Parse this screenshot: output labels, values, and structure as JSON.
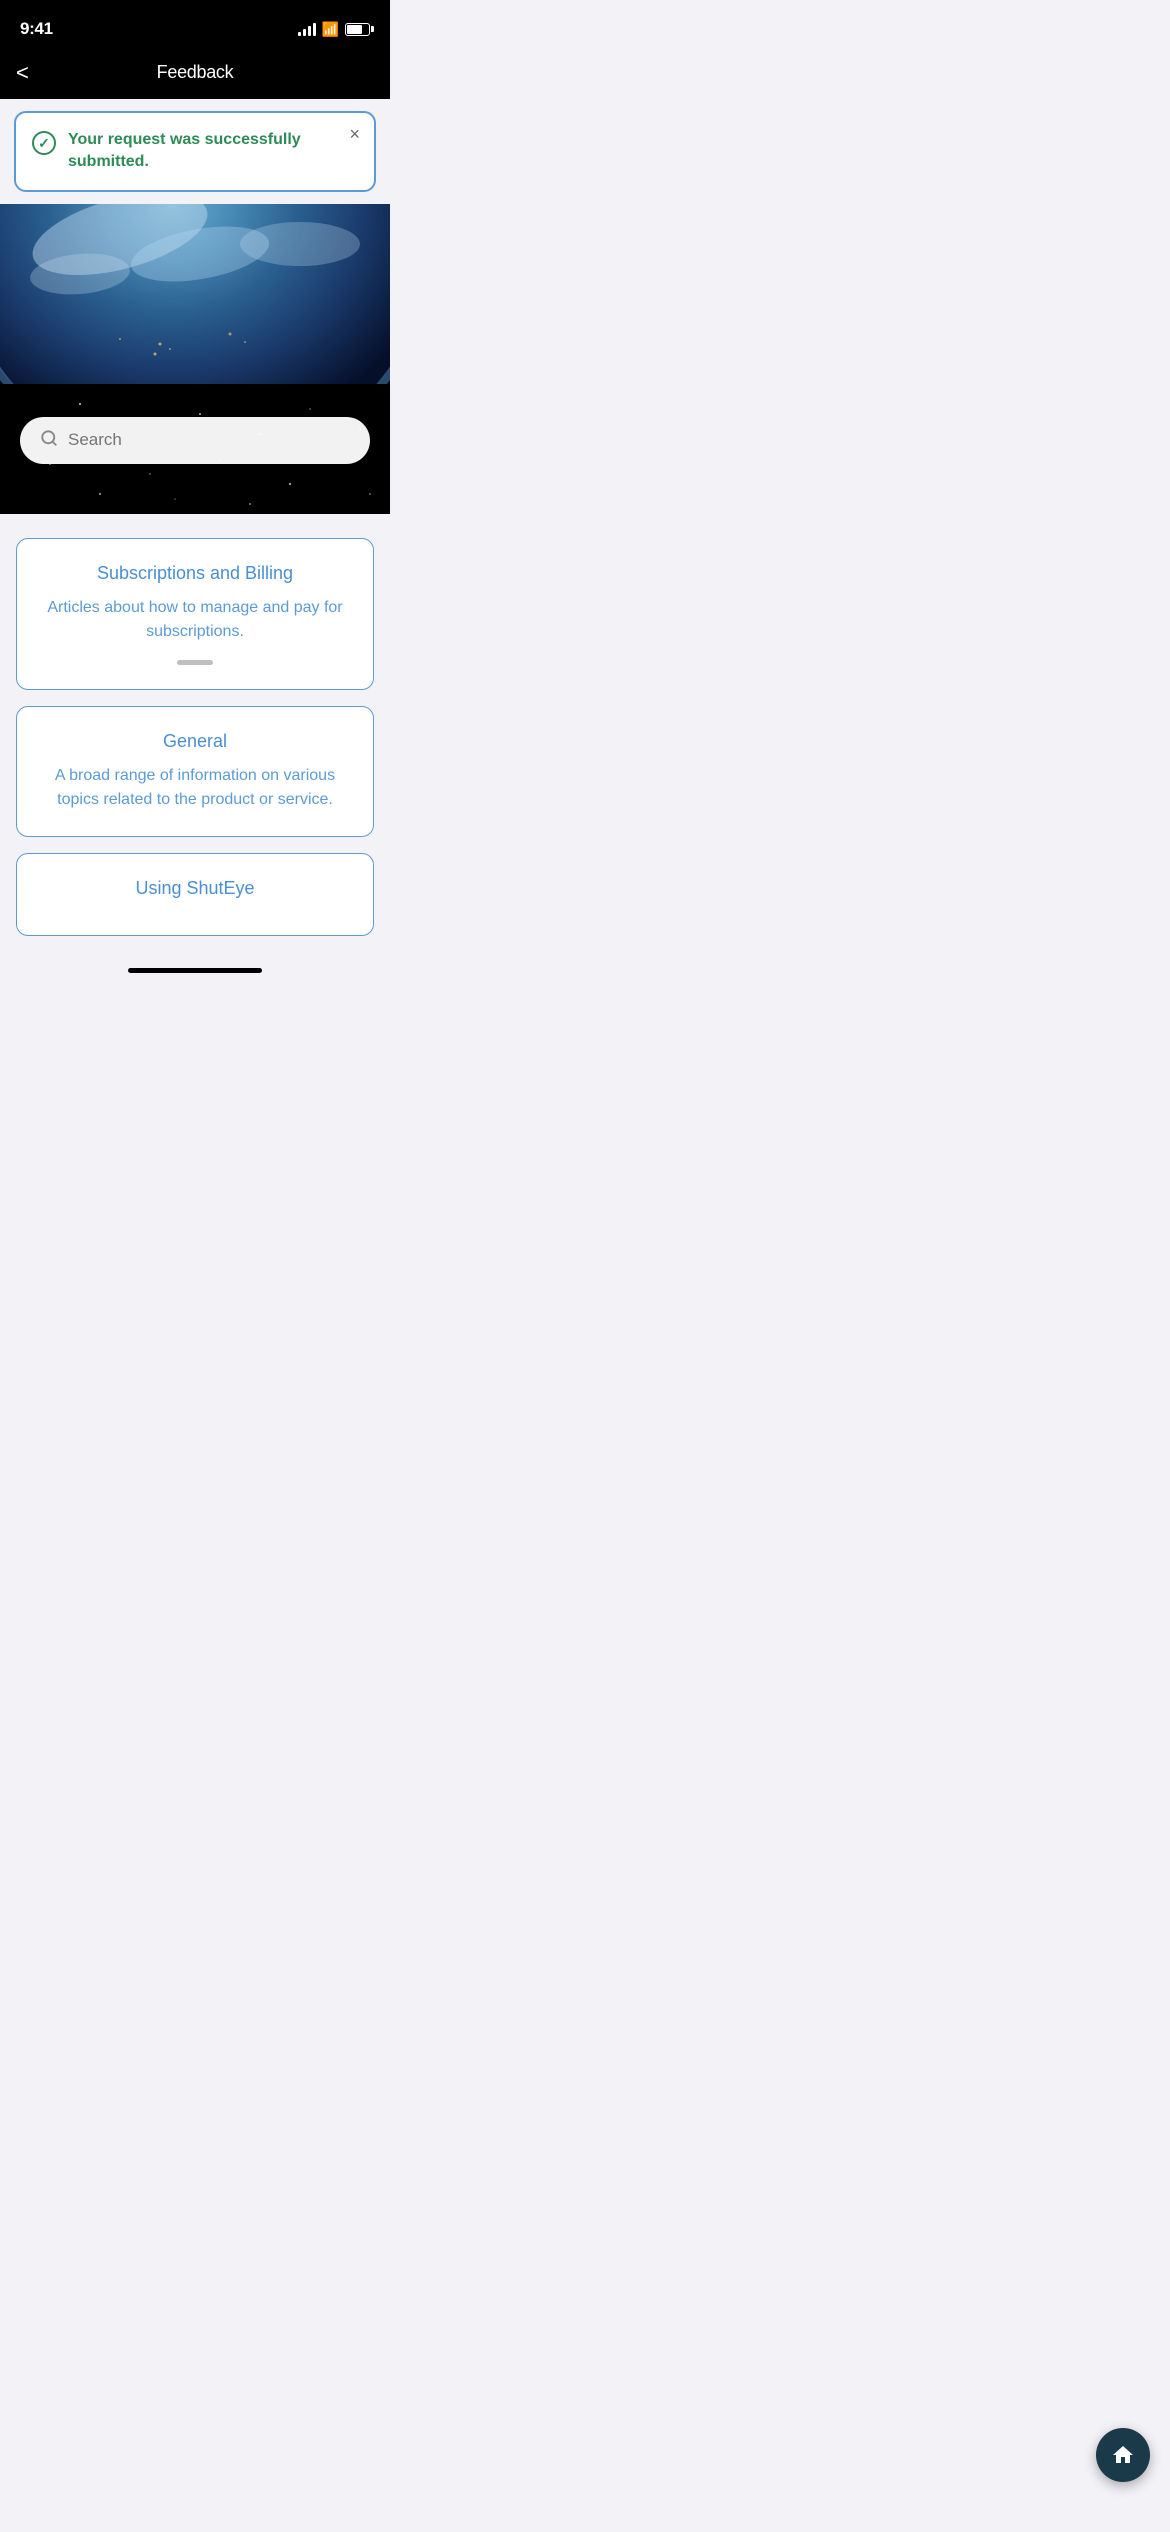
{
  "status_bar": {
    "time": "9:41",
    "signal_alt": "signal bars",
    "wifi_alt": "wifi",
    "battery_alt": "battery"
  },
  "header": {
    "title": "Feedback",
    "back_label": "<"
  },
  "success_banner": {
    "message": "Your request was successfully submitted.",
    "close_label": "×"
  },
  "search": {
    "placeholder": "Search"
  },
  "categories": [
    {
      "title": "Subscriptions and Billing",
      "description": "Articles about how to manage and pay for subscriptions."
    },
    {
      "title": "General",
      "description": "A broad range of information on various topics related to the product or service."
    },
    {
      "title": "Using ShutEye",
      "description": ""
    }
  ],
  "fab": {
    "label": "home"
  }
}
